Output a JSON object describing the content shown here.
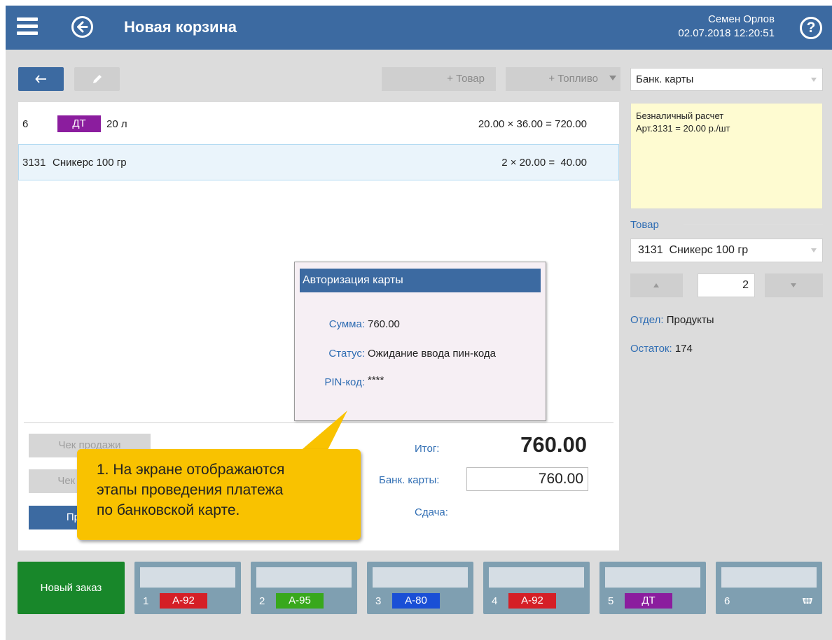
{
  "header": {
    "title": "Новая корзина",
    "user_name": "Семен Орлов",
    "datetime": "02.07.2018 12:20:51",
    "help_label": "?"
  },
  "toolbar": {
    "add_item_label": "+ Товар",
    "add_fuel_label": "+ Топливо"
  },
  "cart": {
    "items": [
      {
        "code": "6",
        "fuel_badge": "ДТ",
        "fuel_badge_color": "#8b1d9e",
        "quantity": "20 л",
        "calc": "20.00 × 36.00 = 720.00"
      },
      {
        "code": "3131",
        "name": "Сникерс 100 гр",
        "calc": "2 × 20.00 =  40.00"
      }
    ]
  },
  "buttons": {
    "receipt_sale": "Чек продажи",
    "receipt_return": "Чек возврата",
    "pay": "Провести"
  },
  "totals": {
    "total_label": "Итог:",
    "total_value": "760.00",
    "payment_label": "Банк. карты:",
    "payment_value": "760.00",
    "change_label": "Сдача:"
  },
  "dialog": {
    "title": "Авторизация карты",
    "sum_label": "Сумма:",
    "sum_value": "760.00",
    "status_label": "Статус:",
    "status_value": "Ожидание ввода пин-кода",
    "pin_label": "PIN-код:",
    "pin_value": "****"
  },
  "callout": {
    "text": "1. На экране отображаются\n   этапы проведения платежа\n   по банковской карте."
  },
  "side": {
    "payment_method": "Банк. карты",
    "info_line1": "Безналичный расчет",
    "info_line2": "Арт.3131 = 20.00 р./шт",
    "item_section_label": "Товар",
    "item_selected": "3131  Сникерс 100 гр",
    "qty_value": "2",
    "dept_label": "Отдел:",
    "dept_value": "Продукты",
    "stock_label": "Остаток:",
    "stock_value": "174"
  },
  "orders": {
    "new_order_label": "Новый заказ",
    "tabs": [
      {
        "num": "1",
        "fuel": "А-92",
        "color": "#d51f26"
      },
      {
        "num": "2",
        "fuel": "А-95",
        "color": "#38a81c"
      },
      {
        "num": "3",
        "fuel": "А-80",
        "color": "#1a4fd6"
      },
      {
        "num": "4",
        "fuel": "А-92",
        "color": "#d51f26"
      },
      {
        "num": "5",
        "fuel": "ДТ",
        "color": "#8b1d9e"
      },
      {
        "num": "6",
        "fuel": "",
        "icon": "cart-icon"
      }
    ]
  },
  "colors": {
    "header_bg": "#3c6aa1",
    "accent_blue": "#2f6db3",
    "new_order_green": "#18872a",
    "callout_yellow": "#f9c200"
  }
}
